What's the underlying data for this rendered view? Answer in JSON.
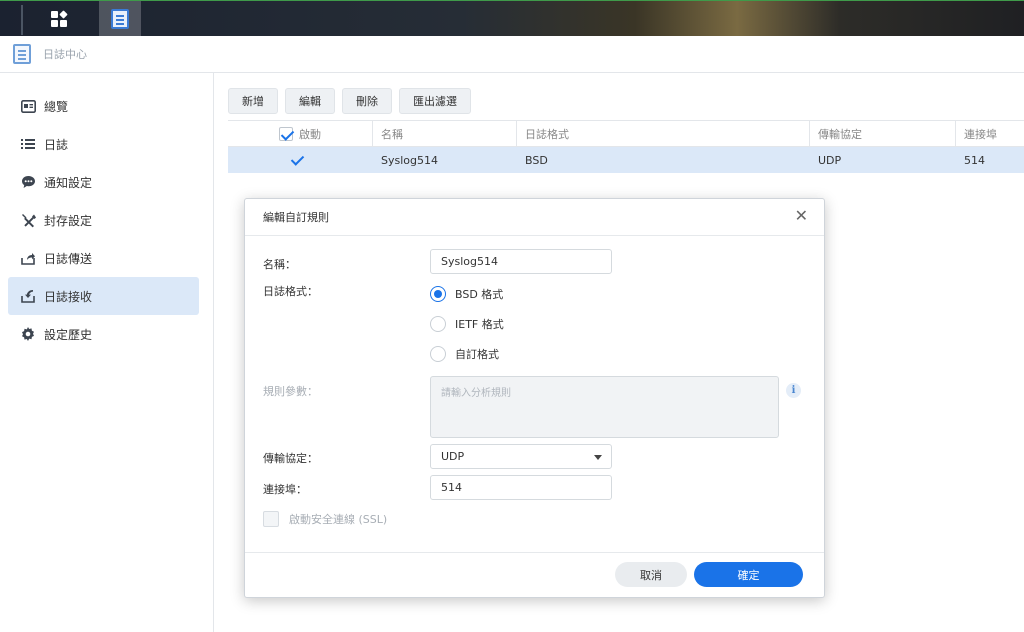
{
  "app": {
    "title": "日誌中心"
  },
  "sidebar": {
    "items": [
      {
        "label": "總覽",
        "icon": "overview-icon"
      },
      {
        "label": "日誌",
        "icon": "list-icon"
      },
      {
        "label": "通知設定",
        "icon": "chat-bubble-icon"
      },
      {
        "label": "封存設定",
        "icon": "tools-icon"
      },
      {
        "label": "日誌傳送",
        "icon": "export-icon"
      },
      {
        "label": "日誌接收",
        "icon": "import-icon",
        "active": true
      },
      {
        "label": "設定歷史",
        "icon": "gear-icon"
      }
    ]
  },
  "toolbar": {
    "add_label": "新增",
    "edit_label": "編輯",
    "delete_label": "刪除",
    "export_label": "匯出濾選"
  },
  "table": {
    "headers": [
      "啟動",
      "名稱",
      "日誌格式",
      "傳輸協定",
      "連接埠"
    ],
    "rows": [
      {
        "enabled": true,
        "name": "Syslog514",
        "format": "BSD",
        "protocol": "UDP",
        "port": "514"
      }
    ]
  },
  "dialog": {
    "title": "編輯自訂規則",
    "name_label": "名稱：",
    "name_value": "Syslog514",
    "format_label": "日誌格式：",
    "format_options": [
      "BSD 格式",
      "IETF 格式",
      "自訂格式"
    ],
    "format_selected": 0,
    "rule_label": "規則參數：",
    "rule_placeholder": "請輸入分析規則",
    "protocol_label": "傳輸協定：",
    "protocol_value": "UDP",
    "port_label": "連接埠：",
    "port_value": "514",
    "ssl_label": "啟動安全連線 (SSL)",
    "cancel_label": "取消",
    "ok_label": "確定"
  },
  "colors": {
    "accent": "#1a73e8",
    "selection": "#dbe8f8"
  }
}
